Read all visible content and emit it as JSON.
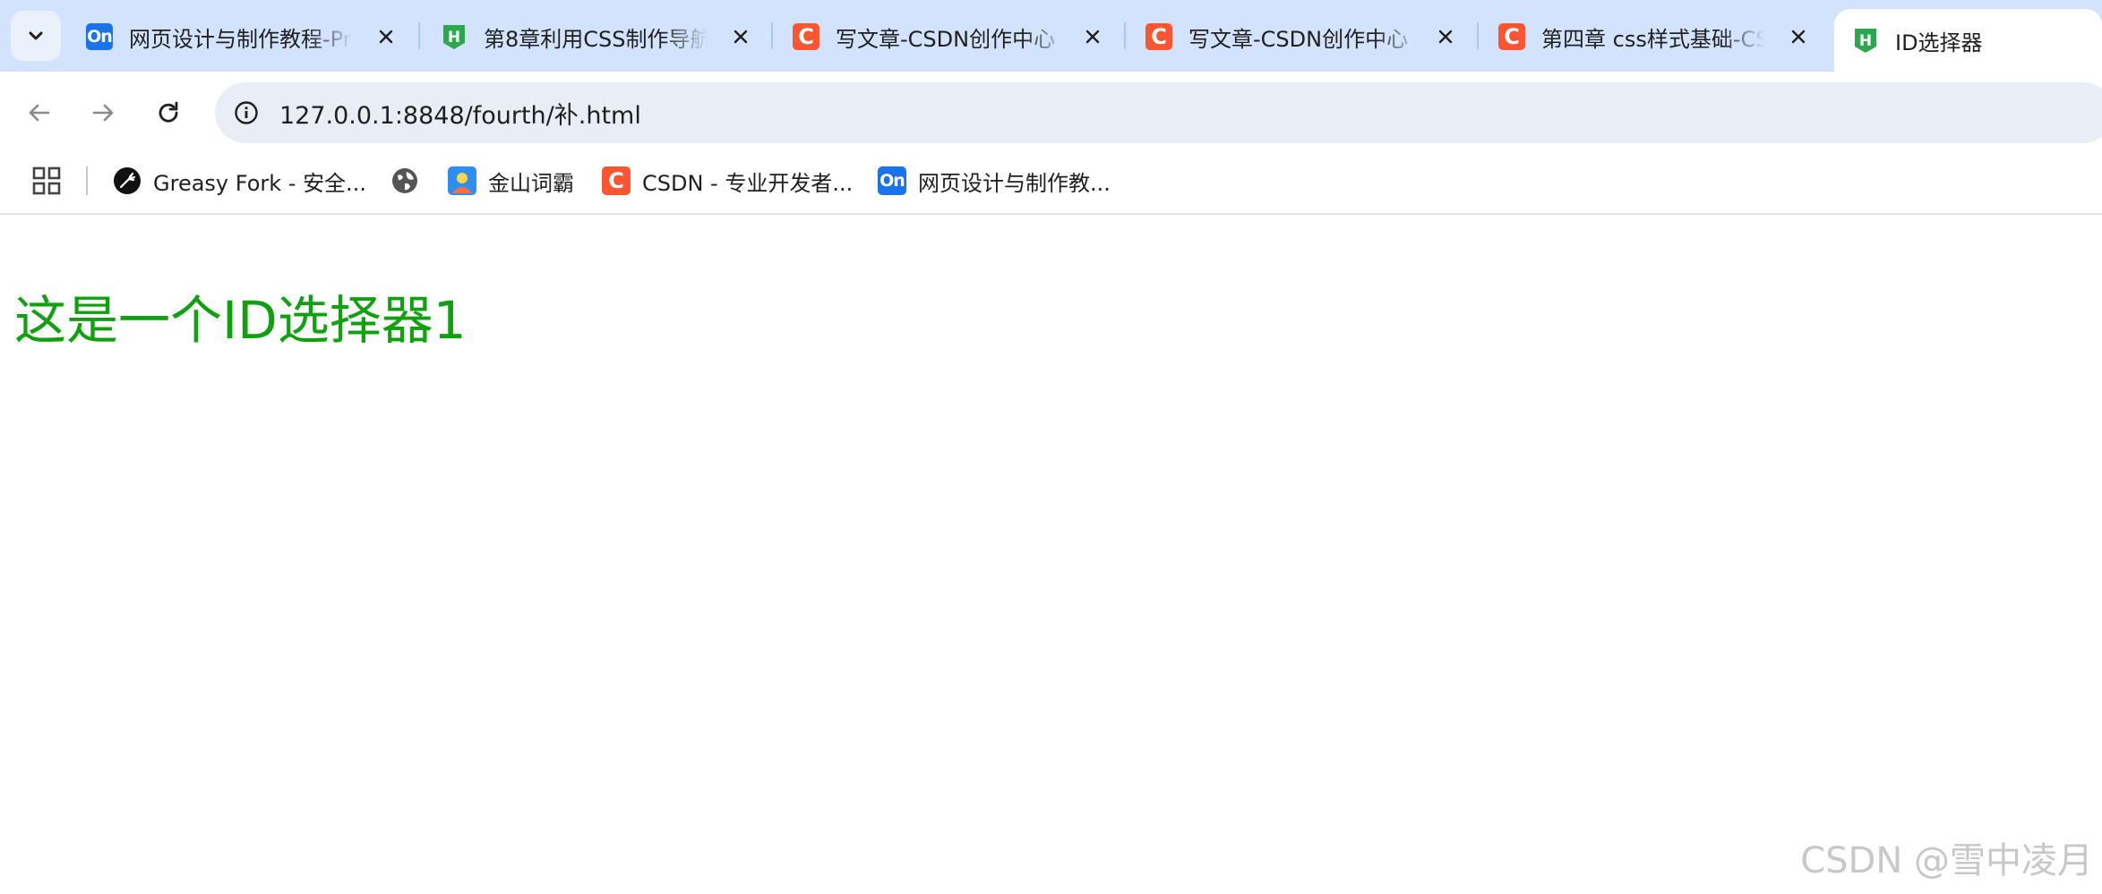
{
  "tabs": [
    {
      "title": "网页设计与制作教程-Pr",
      "favicon": "on-icon",
      "favicon_text": "On"
    },
    {
      "title": "第8章利用CSS制作导航",
      "favicon": "hbuilder-icon",
      "favicon_text": "H"
    },
    {
      "title": "写文章-CSDN创作中心",
      "favicon": "csdn-icon",
      "favicon_text": "C"
    },
    {
      "title": "写文章-CSDN创作中心",
      "favicon": "csdn-icon",
      "favicon_text": "C"
    },
    {
      "title": "第四章 css样式基础-CS",
      "favicon": "csdn-icon",
      "favicon_text": "C"
    },
    {
      "title": "ID选择器",
      "favicon": "hbuilder-icon",
      "favicon_text": "H",
      "active": true
    }
  ],
  "address_bar": {
    "url": "127.0.0.1:8848/fourth/补.html"
  },
  "bookmarks": [
    {
      "label": "Greasy Fork - 安全...",
      "icon": "greasy-fork-icon"
    },
    {
      "label": "",
      "icon": "globe-icon"
    },
    {
      "label": "金山词霸",
      "icon": "iciba-icon"
    },
    {
      "label": "CSDN - 专业开发者...",
      "icon": "csdn-icon",
      "icon_text": "C"
    },
    {
      "label": "网页设计与制作教...",
      "icon": "on-icon",
      "icon_text": "On"
    }
  ],
  "page": {
    "heading": "这是一个ID选择器1",
    "watermark": "CSDN @雪中凌月"
  },
  "colors": {
    "tabstrip": "#d3e3fd",
    "heading": "#10a010",
    "csdn": "#fc5531",
    "on_blue": "#1a73e8",
    "hbuilder_green": "#2aa84a"
  }
}
